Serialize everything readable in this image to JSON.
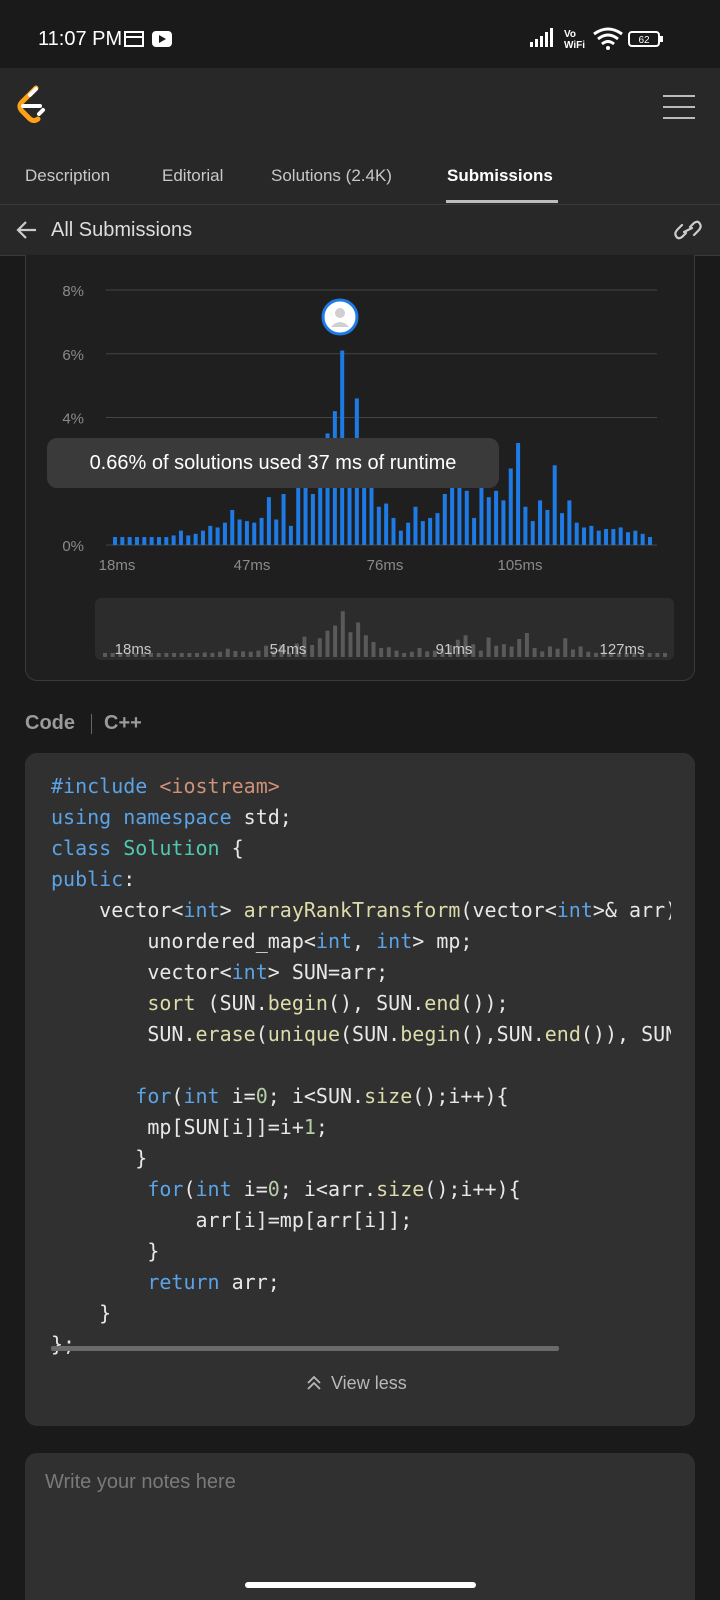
{
  "status_bar": {
    "time": "11:07 PM",
    "volte_label": "Vo WiFi",
    "battery": "62"
  },
  "header": {
    "logo": "leetcode-logo",
    "menu_icon": "hamburger-icon"
  },
  "tabs": [
    {
      "label": "Description",
      "active": false
    },
    {
      "label": "Editorial",
      "active": false
    },
    {
      "label": "Solutions (2.4K)",
      "active": false
    },
    {
      "label": "Submissions",
      "active": true
    }
  ],
  "subheader": {
    "back_label": "All Submissions",
    "link_icon": "link-icon"
  },
  "chart_data": {
    "type": "bar",
    "y_ticks": [
      "8%",
      "6%",
      "4%",
      "0%"
    ],
    "ylim": [
      0,
      8
    ],
    "x_ticks": [
      "18ms",
      "47ms",
      "76ms",
      "105ms"
    ],
    "accent_color": "#1e7be6",
    "tooltip": "0.66% of solutions used 37 ms of runtime",
    "selected_x": "37ms",
    "values": [
      0.25,
      0.25,
      0.25,
      0.25,
      0.25,
      0.25,
      0.25,
      0.25,
      0.3,
      0.45,
      0.3,
      0.35,
      0.45,
      0.6,
      0.55,
      0.7,
      1.1,
      0.8,
      0.75,
      0.7,
      0.85,
      1.5,
      0.8,
      1.6,
      0.6,
      1.8,
      2.7,
      1.6,
      2.5,
      3.5,
      4.2,
      6.1,
      3.3,
      4.6,
      2.9,
      2.0,
      1.2,
      1.3,
      0.85,
      0.45,
      0.7,
      1.2,
      0.75,
      0.85,
      1.0,
      1.6,
      2.3,
      2.9,
      1.7,
      0.85,
      2.6,
      1.5,
      1.7,
      1.4,
      2.4,
      3.2,
      1.2,
      0.75,
      1.4,
      1.1,
      2.5,
      1.0,
      1.4,
      0.7,
      0.55,
      0.6,
      0.45,
      0.5,
      0.5,
      0.55,
      0.4,
      0.45,
      0.35,
      0.25
    ],
    "range_slider": {
      "labels": [
        "18ms",
        "54ms",
        "91ms",
        "127ms"
      ]
    }
  },
  "code_section": {
    "label": "Code",
    "language": "C++",
    "view_less": "View less"
  },
  "code_lines": [
    "#include <iostream>",
    "using namespace std;",
    "class Solution {",
    "public:",
    "    vector<int> arrayRankTransform(vector<int>& arr) {",
    "        unordered_map<int, int> mp;",
    "        vector<int> SUN=arr;",
    "        sort (SUN.begin(), SUN.end());",
    "        SUN.erase(unique(SUN.begin(),SUN.end()), SUN.end());",
    "",
    "       for(int i=0; i<SUN.size();i++){",
    "        mp[SUN[i]]=i+1;",
    "       }",
    "        for(int i=0; i<arr.size();i++){",
    "            arr[i]=mp[arr[i]];",
    "        }",
    "        return arr;",
    "    }",
    "};"
  ],
  "notes": {
    "placeholder": "Write your notes here"
  }
}
